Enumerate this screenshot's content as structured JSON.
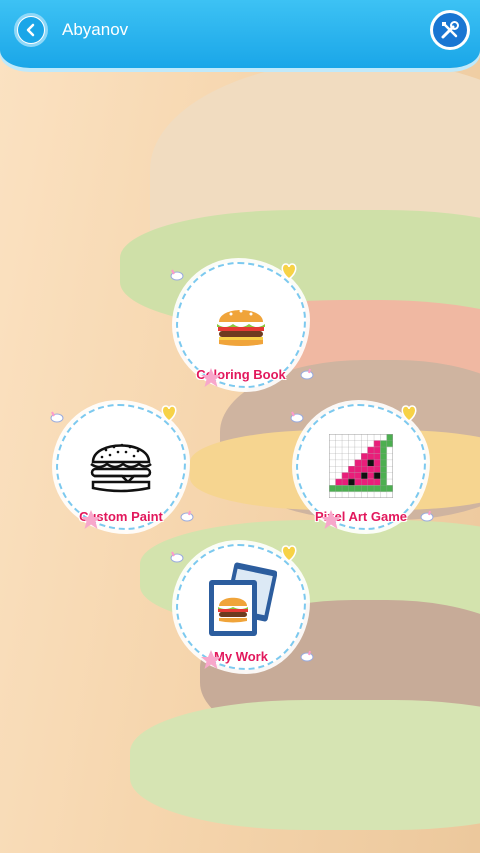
{
  "header": {
    "title": "Abyanov",
    "back_icon": "back-arrow-icon",
    "tools_icon": "tools-icon"
  },
  "menu": {
    "coloring_book": {
      "label": "Coloring Book",
      "icon": "burger-icon"
    },
    "custom_paint": {
      "label": "Custom Paint",
      "icon": "burger-outline-icon"
    },
    "pixel_art_game": {
      "label": "Pixel Art Game",
      "icon": "watermelon-pixel-icon"
    },
    "my_work": {
      "label": "My Work",
      "icon": "photo-gallery-icon"
    }
  },
  "colors": {
    "header": "#1aa6e8",
    "label": "#e2185c",
    "cloud_border": "#7cc9ef"
  }
}
